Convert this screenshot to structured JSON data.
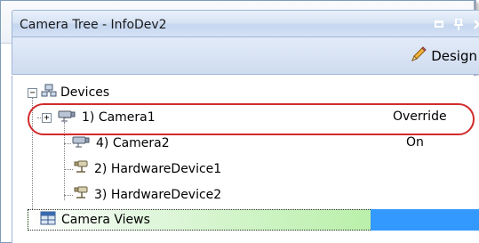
{
  "window": {
    "title": "Camera Tree - InfoDev2",
    "icons": [
      "maximize-icon",
      "pin-icon",
      "close-icon"
    ]
  },
  "toolbar": {
    "design_label": "Design",
    "design_icon": "pencil-icon"
  },
  "tree": {
    "root": {
      "label": "Devices",
      "expander": "−",
      "icon": "devices-icon"
    },
    "items": [
      {
        "label": "1) Camera1",
        "status": "Override",
        "expander": "+",
        "icon": "camera-icon",
        "highlighted": true
      },
      {
        "label": "4) Camera2",
        "status": "On",
        "icon": "camera-icon"
      },
      {
        "label": "2) HardwareDevice1",
        "status": "",
        "icon": "hardware-device-icon"
      },
      {
        "label": "3) HardwareDevice2",
        "status": "",
        "icon": "hardware-device-icon"
      }
    ],
    "views": {
      "label": "Camera Views",
      "icon": "camera-views-icon",
      "selected": true
    }
  },
  "colors": {
    "highlight": "#d22b2b",
    "selection": "#3399ff",
    "titlebar": "#c4d6ef"
  }
}
